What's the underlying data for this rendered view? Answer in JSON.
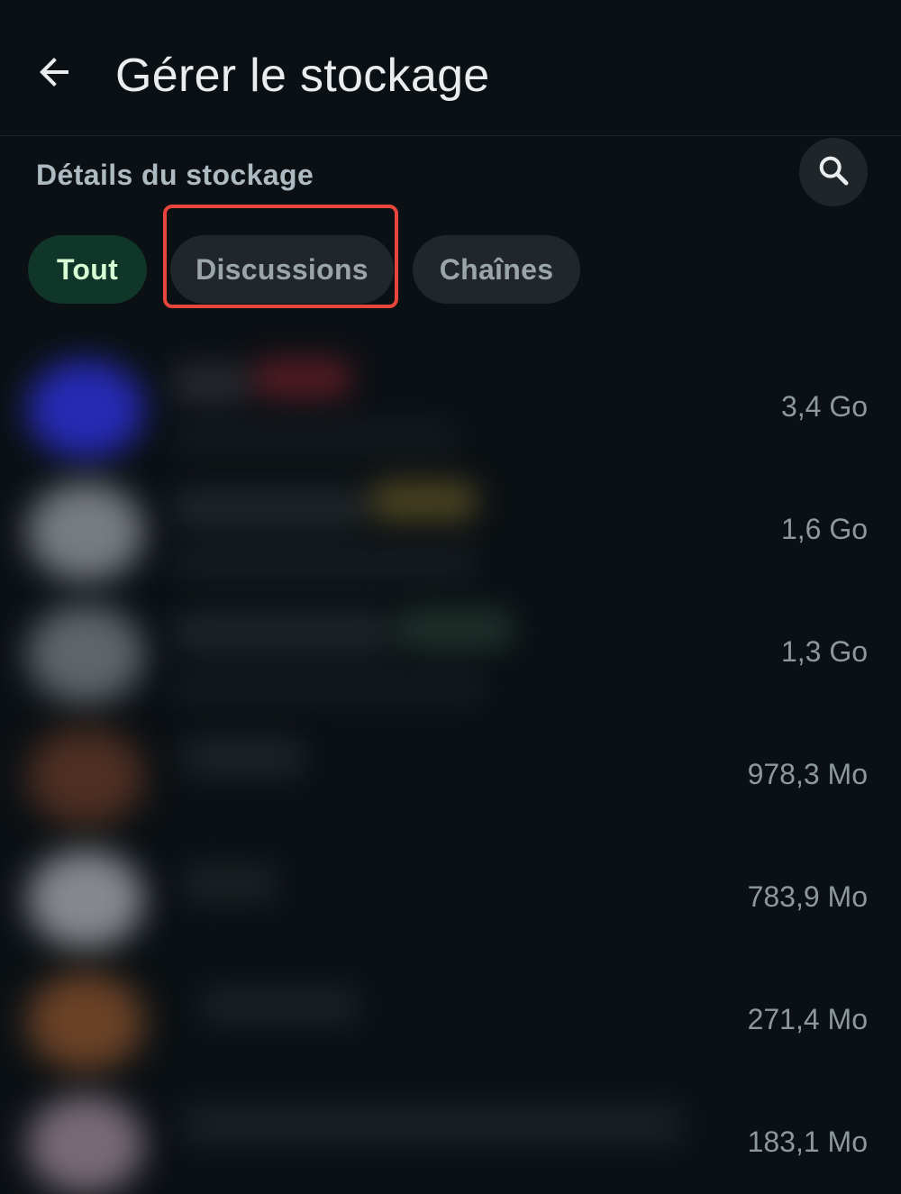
{
  "header": {
    "title": "Gérer le stockage",
    "back_icon": "arrow-back-icon"
  },
  "section": {
    "title": "Détails du stockage",
    "search_icon": "search-icon"
  },
  "filters": {
    "all": "Tout",
    "discussions": "Discussions",
    "channels": "Chaînes",
    "selected": "Tout",
    "highlighted": "Discussions",
    "highlight_color": "#e8453c"
  },
  "chats": [
    {
      "size": "3,4 Go"
    },
    {
      "size": "1,6 Go"
    },
    {
      "size": "1,3 Go"
    },
    {
      "size": "978,3 Mo"
    },
    {
      "size": "783,9 Mo"
    },
    {
      "size": "271,4 Mo"
    },
    {
      "size": "183,1 Mo"
    }
  ],
  "colors": {
    "background": "#0b1014",
    "chip_selected_bg": "#103529",
    "chip_selected_text": "#d9fdd3",
    "chip_bg": "#202629"
  }
}
